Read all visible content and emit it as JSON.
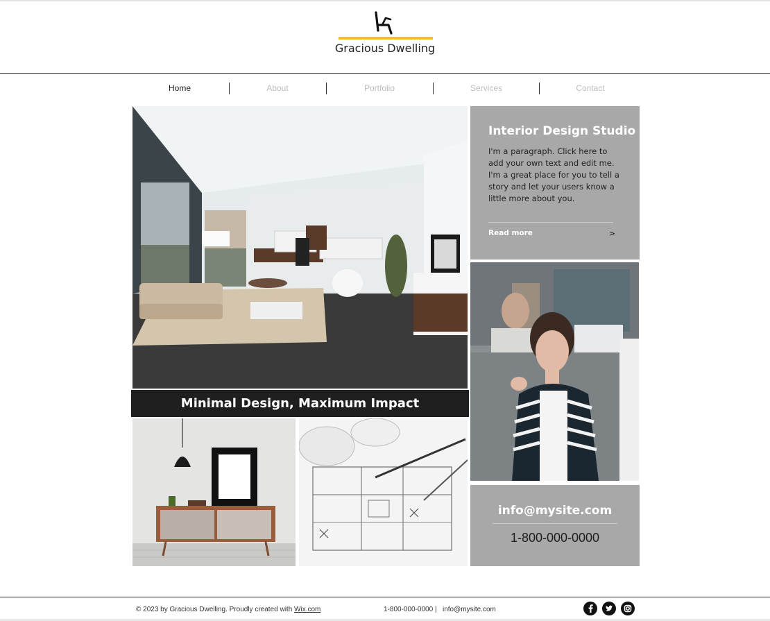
{
  "brand": {
    "name": "Gracious Dwelling",
    "accent_color": "#f1c21b",
    "logo_icon": "chair-icon"
  },
  "nav": {
    "items": [
      {
        "label": "Home",
        "active": true
      },
      {
        "label": "About",
        "active": false
      },
      {
        "label": "Portfolio",
        "active": false
      },
      {
        "label": "Services",
        "active": false
      },
      {
        "label": "Contact",
        "active": false
      }
    ]
  },
  "hero": {
    "image": "living-room-photo",
    "banner": "Minimal Design, Maximum Impact"
  },
  "studio": {
    "title": "Interior Design Studio",
    "paragraph": "I'm a paragraph. Click here to add your own text and edit me. I'm a great place for you to tell a story and let your users know a little more about you.",
    "read_more": "Read more",
    "arrow": ">",
    "box_color": "#a8a8a8"
  },
  "gallery": {
    "images": [
      "sideboard-photo",
      "blueprints-photo",
      "woman-portrait-photo"
    ]
  },
  "contact": {
    "email": "info@mysite.com",
    "phone": "1-800-000-0000"
  },
  "footer": {
    "copyright": "© 2023 by Gracious Dwelling. Proudly created with ",
    "wix_link": "Wix.com",
    "phone": "1-800-000-0000",
    "divider": "|",
    "email": "info@mysite.com",
    "social": [
      "facebook-icon",
      "twitter-icon",
      "instagram-icon"
    ]
  }
}
